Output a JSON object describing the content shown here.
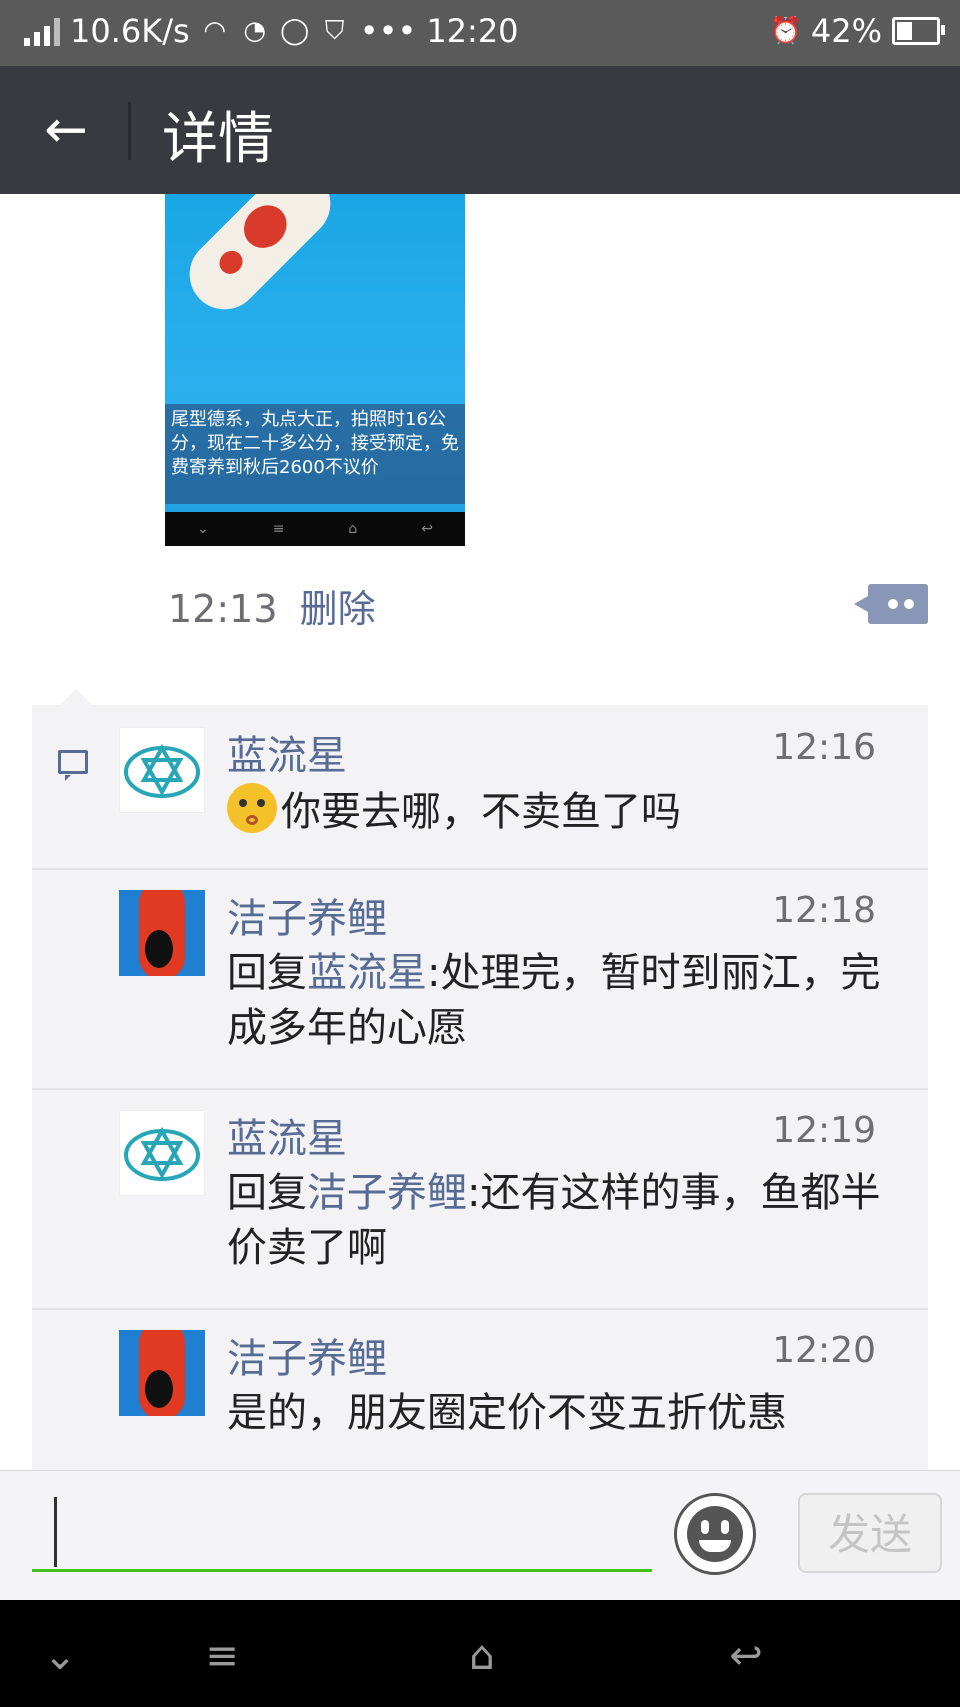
{
  "status_bar": {
    "net_speed": "10.6K/s",
    "clock": "12:20",
    "battery": "42%",
    "battery_level": 0.42,
    "dots": "•••"
  },
  "header": {
    "title": "详情",
    "back_icon": "arrow-left-icon"
  },
  "post": {
    "image_caption": "尾型德系，丸点大正，拍照时16公分，现在二十多公分，接受预定，免费寄养到秋后2600不议价",
    "time": "12:13",
    "delete_label": "删除"
  },
  "comments": [
    {
      "name": "蓝流星",
      "time": "12:16",
      "text": "你要去哪，不卖鱼了吗",
      "has_emoji": true
    },
    {
      "name": "洁子养鲤",
      "time": "12:18",
      "reply_prefix": "回复",
      "reply_to": "蓝流星",
      "text": ":处理完，暂时到丽江，完成多年的心愿"
    },
    {
      "name": "蓝流星",
      "time": "12:19",
      "reply_prefix": "回复",
      "reply_to": "洁子养鲤",
      "text": ":还有这样的事，鱼都半价卖了啊"
    },
    {
      "name": "洁子养鲤",
      "time": "12:20",
      "text": "是的，朋友圈定价不变五折优惠"
    }
  ],
  "input": {
    "placeholder": "",
    "send_label": "发送"
  },
  "colors": {
    "link": "#576b95",
    "appbar": "#393a3f",
    "input_underline": "#45c01a"
  }
}
